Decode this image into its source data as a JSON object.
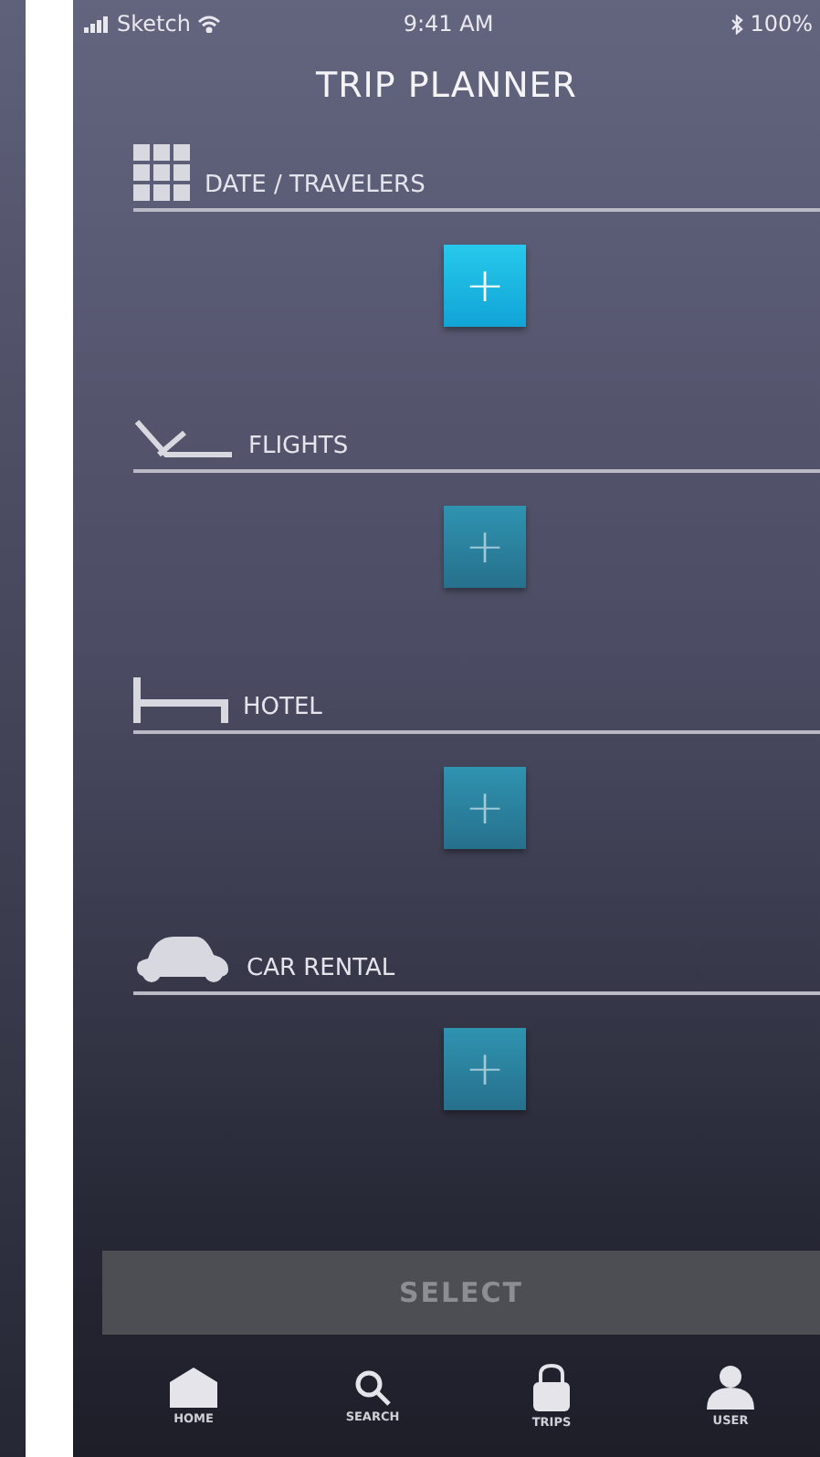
{
  "status_bar": {
    "carrier": "Sketch",
    "time": "9:41 AM",
    "battery": "100%"
  },
  "title": "TRIP PLANNER",
  "sections": [
    {
      "kind": "calendar",
      "label": "DATE / TRAVELERS",
      "active": true,
      "button": "+"
    },
    {
      "kind": "plane",
      "label": "FLIGHTS",
      "active": false,
      "button": "+"
    },
    {
      "kind": "bed",
      "label": "HOTEL",
      "active": false,
      "button": "+"
    },
    {
      "kind": "car",
      "label": "CAR RENTAL",
      "active": false,
      "button": "+"
    }
  ],
  "select_button": "SELECT",
  "tabs": [
    {
      "kind": "home",
      "label": "HOME"
    },
    {
      "kind": "search",
      "label": "SEARCH"
    },
    {
      "kind": "trips",
      "label": "TRIPS"
    },
    {
      "kind": "user",
      "label": "USER"
    }
  ]
}
